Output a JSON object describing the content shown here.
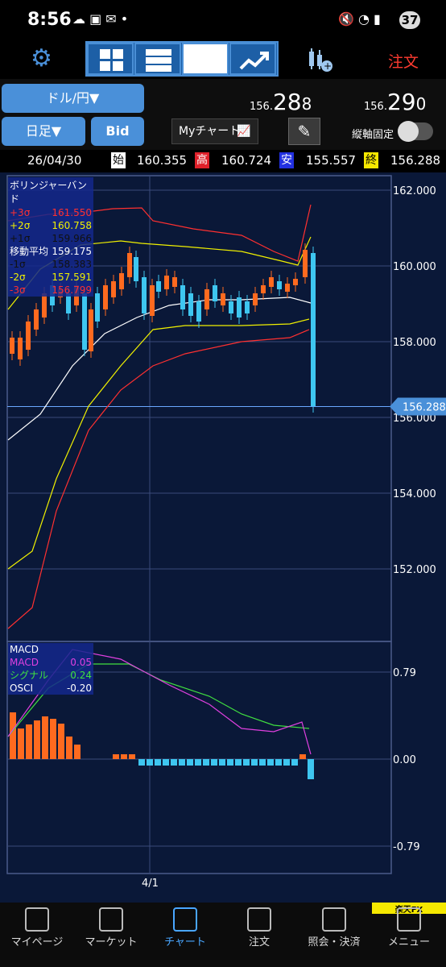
{
  "status": {
    "time": "8:56",
    "battery": "37"
  },
  "toolbar": {
    "order_label": "注文"
  },
  "controls": {
    "pair_label": "ドル/円▼",
    "period_label": "日足▼",
    "bid_label": "Bid",
    "mychart_label": "Myチャート",
    "axis_fix_label": "縦軸固定"
  },
  "prices": {
    "bid_prefix": "156.",
    "bid_main": "28",
    "bid_suffix": "8",
    "ask_prefix": "156.",
    "ask_main": "29",
    "ask_suffix": "0"
  },
  "ohlc": {
    "date": "26/04/30",
    "open_tag": "始",
    "open": "160.355",
    "high_tag": "高",
    "high": "160.724",
    "low_tag": "安",
    "low": "155.557",
    "close_tag": "終",
    "close": "156.288",
    "tag_colors": {
      "open": "#ffffff",
      "high": "#e0202a",
      "low": "#2230e0",
      "close": "#f5e800"
    }
  },
  "bollinger": {
    "title": "ボリンジャーバンド",
    "rows": [
      {
        "label": "+3σ",
        "value": "161.550",
        "color": "#ff3030"
      },
      {
        "label": "+2σ",
        "value": "160.758",
        "color": "#f0f000"
      },
      {
        "label": "+1σ",
        "value": "159.966",
        "color": "#101010"
      },
      {
        "label": "移動平均",
        "value": "159.175",
        "color": "#ffffff"
      },
      {
        "label": "-1σ",
        "value": "158.383",
        "color": "#101010"
      },
      {
        "label": "-2σ",
        "value": "157.591",
        "color": "#f0f000"
      },
      {
        "label": "-3σ",
        "value": "156.799",
        "color": "#ff3030"
      }
    ]
  },
  "macd": {
    "title": "MACD",
    "rows": [
      {
        "label": "MACD",
        "value": "0.05",
        "color": "#e040e0"
      },
      {
        "label": "シグナル",
        "value": "0.24",
        "color": "#40e040"
      },
      {
        "label": "OSCI",
        "value": "-0.20",
        "color": "#ffffff"
      }
    ]
  },
  "axes": {
    "price_ticks": [
      "162.000",
      "160.000",
      "158.000",
      "156.000",
      "154.000",
      "152.000"
    ],
    "current_price": "156.288",
    "macd_ticks": [
      "0.79",
      "0.00",
      "-0.79"
    ],
    "date_label": "4/1"
  },
  "colors": {
    "up": "#ff6a1f",
    "down": "#3ec6f0",
    "chart_bg": "#0a1838",
    "accent": "#4a90d9"
  },
  "nav": {
    "items": [
      {
        "label": "マイページ",
        "icon": "book-icon"
      },
      {
        "label": "マーケット",
        "icon": "globe-icon"
      },
      {
        "label": "チャート",
        "icon": "candlestick-icon"
      },
      {
        "label": "注文",
        "icon": "order-icon"
      },
      {
        "label": "照会・決済",
        "icon": "document-icon"
      },
      {
        "label": "メニュー",
        "icon": "menu-icon"
      }
    ],
    "brand": "楽天FX"
  }
}
